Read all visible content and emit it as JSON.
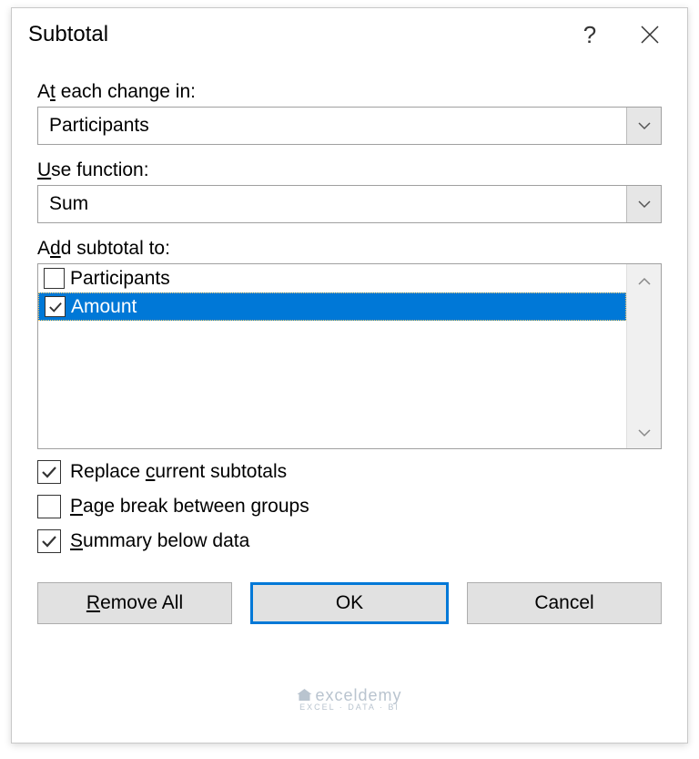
{
  "title": "Subtotal",
  "labels": {
    "change_in_pre": "A",
    "change_in_mid": "t",
    "change_in_post": " each change in:",
    "use_fn_pre": "",
    "use_fn_mid": "U",
    "use_fn_post": "se function:",
    "add_sub_pre": "A",
    "add_sub_mid": "d",
    "add_sub_post": "d subtotal to:"
  },
  "change_in": {
    "value": "Participants"
  },
  "use_function": {
    "value": "Sum"
  },
  "subtotal_items": [
    {
      "label": "Participants",
      "checked": false,
      "selected": false
    },
    {
      "label": "Amount",
      "checked": true,
      "selected": true
    }
  ],
  "options": {
    "replace_pre": "Replace ",
    "replace_mid": "c",
    "replace_post": "urrent subtotals",
    "replace_checked": true,
    "page_pre": "",
    "page_mid": "P",
    "page_post": "age break between groups",
    "page_checked": false,
    "summary_pre": "",
    "summary_mid": "S",
    "summary_post": "ummary below data",
    "summary_checked": true
  },
  "buttons": {
    "remove_pre": "",
    "remove_mid": "R",
    "remove_post": "emove All",
    "ok": "OK",
    "cancel": "Cancel"
  },
  "watermark": {
    "top": "exceldemy",
    "bottom": "EXCEL · DATA · BI"
  }
}
